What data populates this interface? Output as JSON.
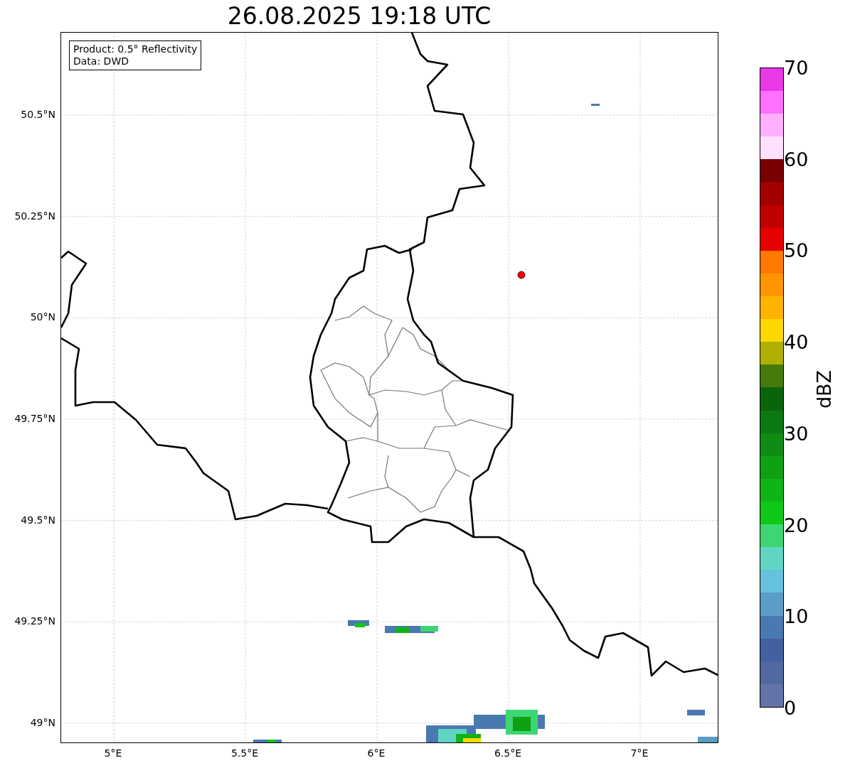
{
  "title": "26.08.2025 19:18 UTC",
  "info_box": [
    "Product: 0.5° Reflectivity",
    "Data: DWD"
  ],
  "map": {
    "xticks": [
      "5°E",
      "5.5°E",
      "6°E",
      "6.5°E",
      "7°E"
    ],
    "yticks": [
      "50.5°N",
      "50.25°N",
      "50°N",
      "49.75°N",
      "49.5°N",
      "49.25°N",
      "49°N"
    ]
  },
  "colorbar": {
    "label": "dBZ",
    "ticks": [
      "70",
      "60",
      "50",
      "40",
      "30",
      "20",
      "10",
      "0"
    ],
    "bands": [
      {
        "color": "#6574a8"
      },
      {
        "color": "#52699f"
      },
      {
        "color": "#4360a0"
      },
      {
        "color": "#4a79b0"
      },
      {
        "color": "#5a9ec5"
      },
      {
        "color": "#66c2dc"
      },
      {
        "color": "#5fd6c4"
      },
      {
        "color": "#3ed672"
      },
      {
        "color": "#10c818"
      },
      {
        "color": "#10b418"
      },
      {
        "color": "#10a014"
      },
      {
        "color": "#0e8c14"
      },
      {
        "color": "#0c7814"
      },
      {
        "color": "#0a640c"
      },
      {
        "color": "#467a0c"
      },
      {
        "color": "#b0b000"
      },
      {
        "color": "#ffd700"
      },
      {
        "color": "#ffb400"
      },
      {
        "color": "#ff9600"
      },
      {
        "color": "#ff7800"
      },
      {
        "color": "#e60000"
      },
      {
        "color": "#c00000"
      },
      {
        "color": "#a00000"
      },
      {
        "color": "#780000"
      },
      {
        "color": "#ffe0ff"
      },
      {
        "color": "#ffb0ff"
      },
      {
        "color": "#ff70ff"
      },
      {
        "color": "#e838e8"
      }
    ]
  }
}
